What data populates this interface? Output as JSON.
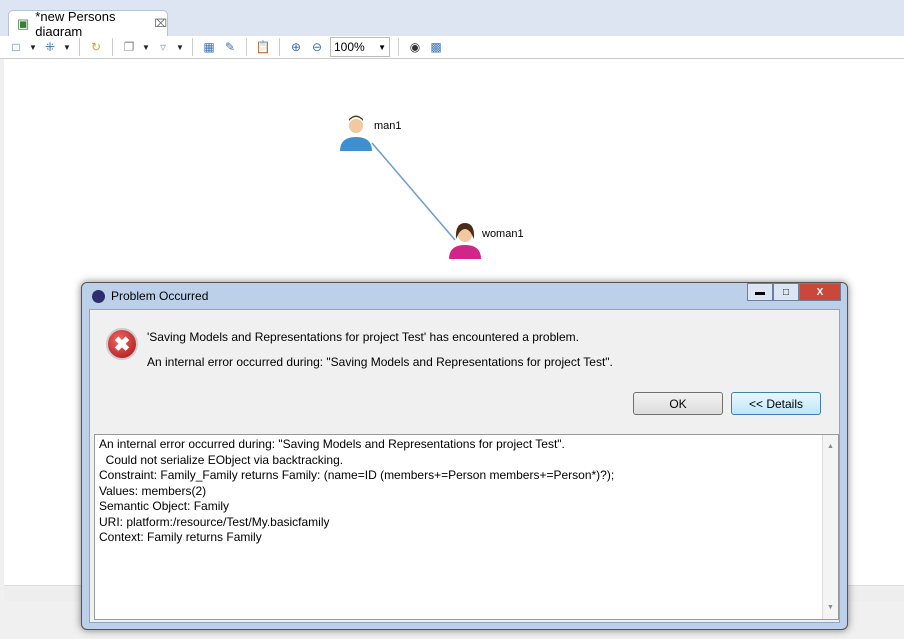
{
  "tab": {
    "title": "*new Persons diagram"
  },
  "toolbar": {
    "zoom": "100%"
  },
  "diagram": {
    "nodes": [
      {
        "label": "man1"
      },
      {
        "label": "woman1"
      }
    ]
  },
  "dialog": {
    "title": "Problem Occurred",
    "message": "'Saving Models and Representations for project Test' has encountered a problem.",
    "detail_message": "An internal error occurred during: \"Saving Models and Representations for project Test\".",
    "ok_label": "OK",
    "details_label": "<< Details",
    "details_lines": [
      "An internal error occurred during: \"Saving Models and Representations for project Test\".",
      "  Could not serialize EObject via backtracking.",
      "Constraint: Family_Family returns Family: (name=ID (members+=Person members+=Person*)?);",
      "Values: members(2)",
      "Semantic Object: Family",
      "URI: platform:/resource/Test/My.basicfamily",
      "Context: Family returns Family"
    ]
  }
}
